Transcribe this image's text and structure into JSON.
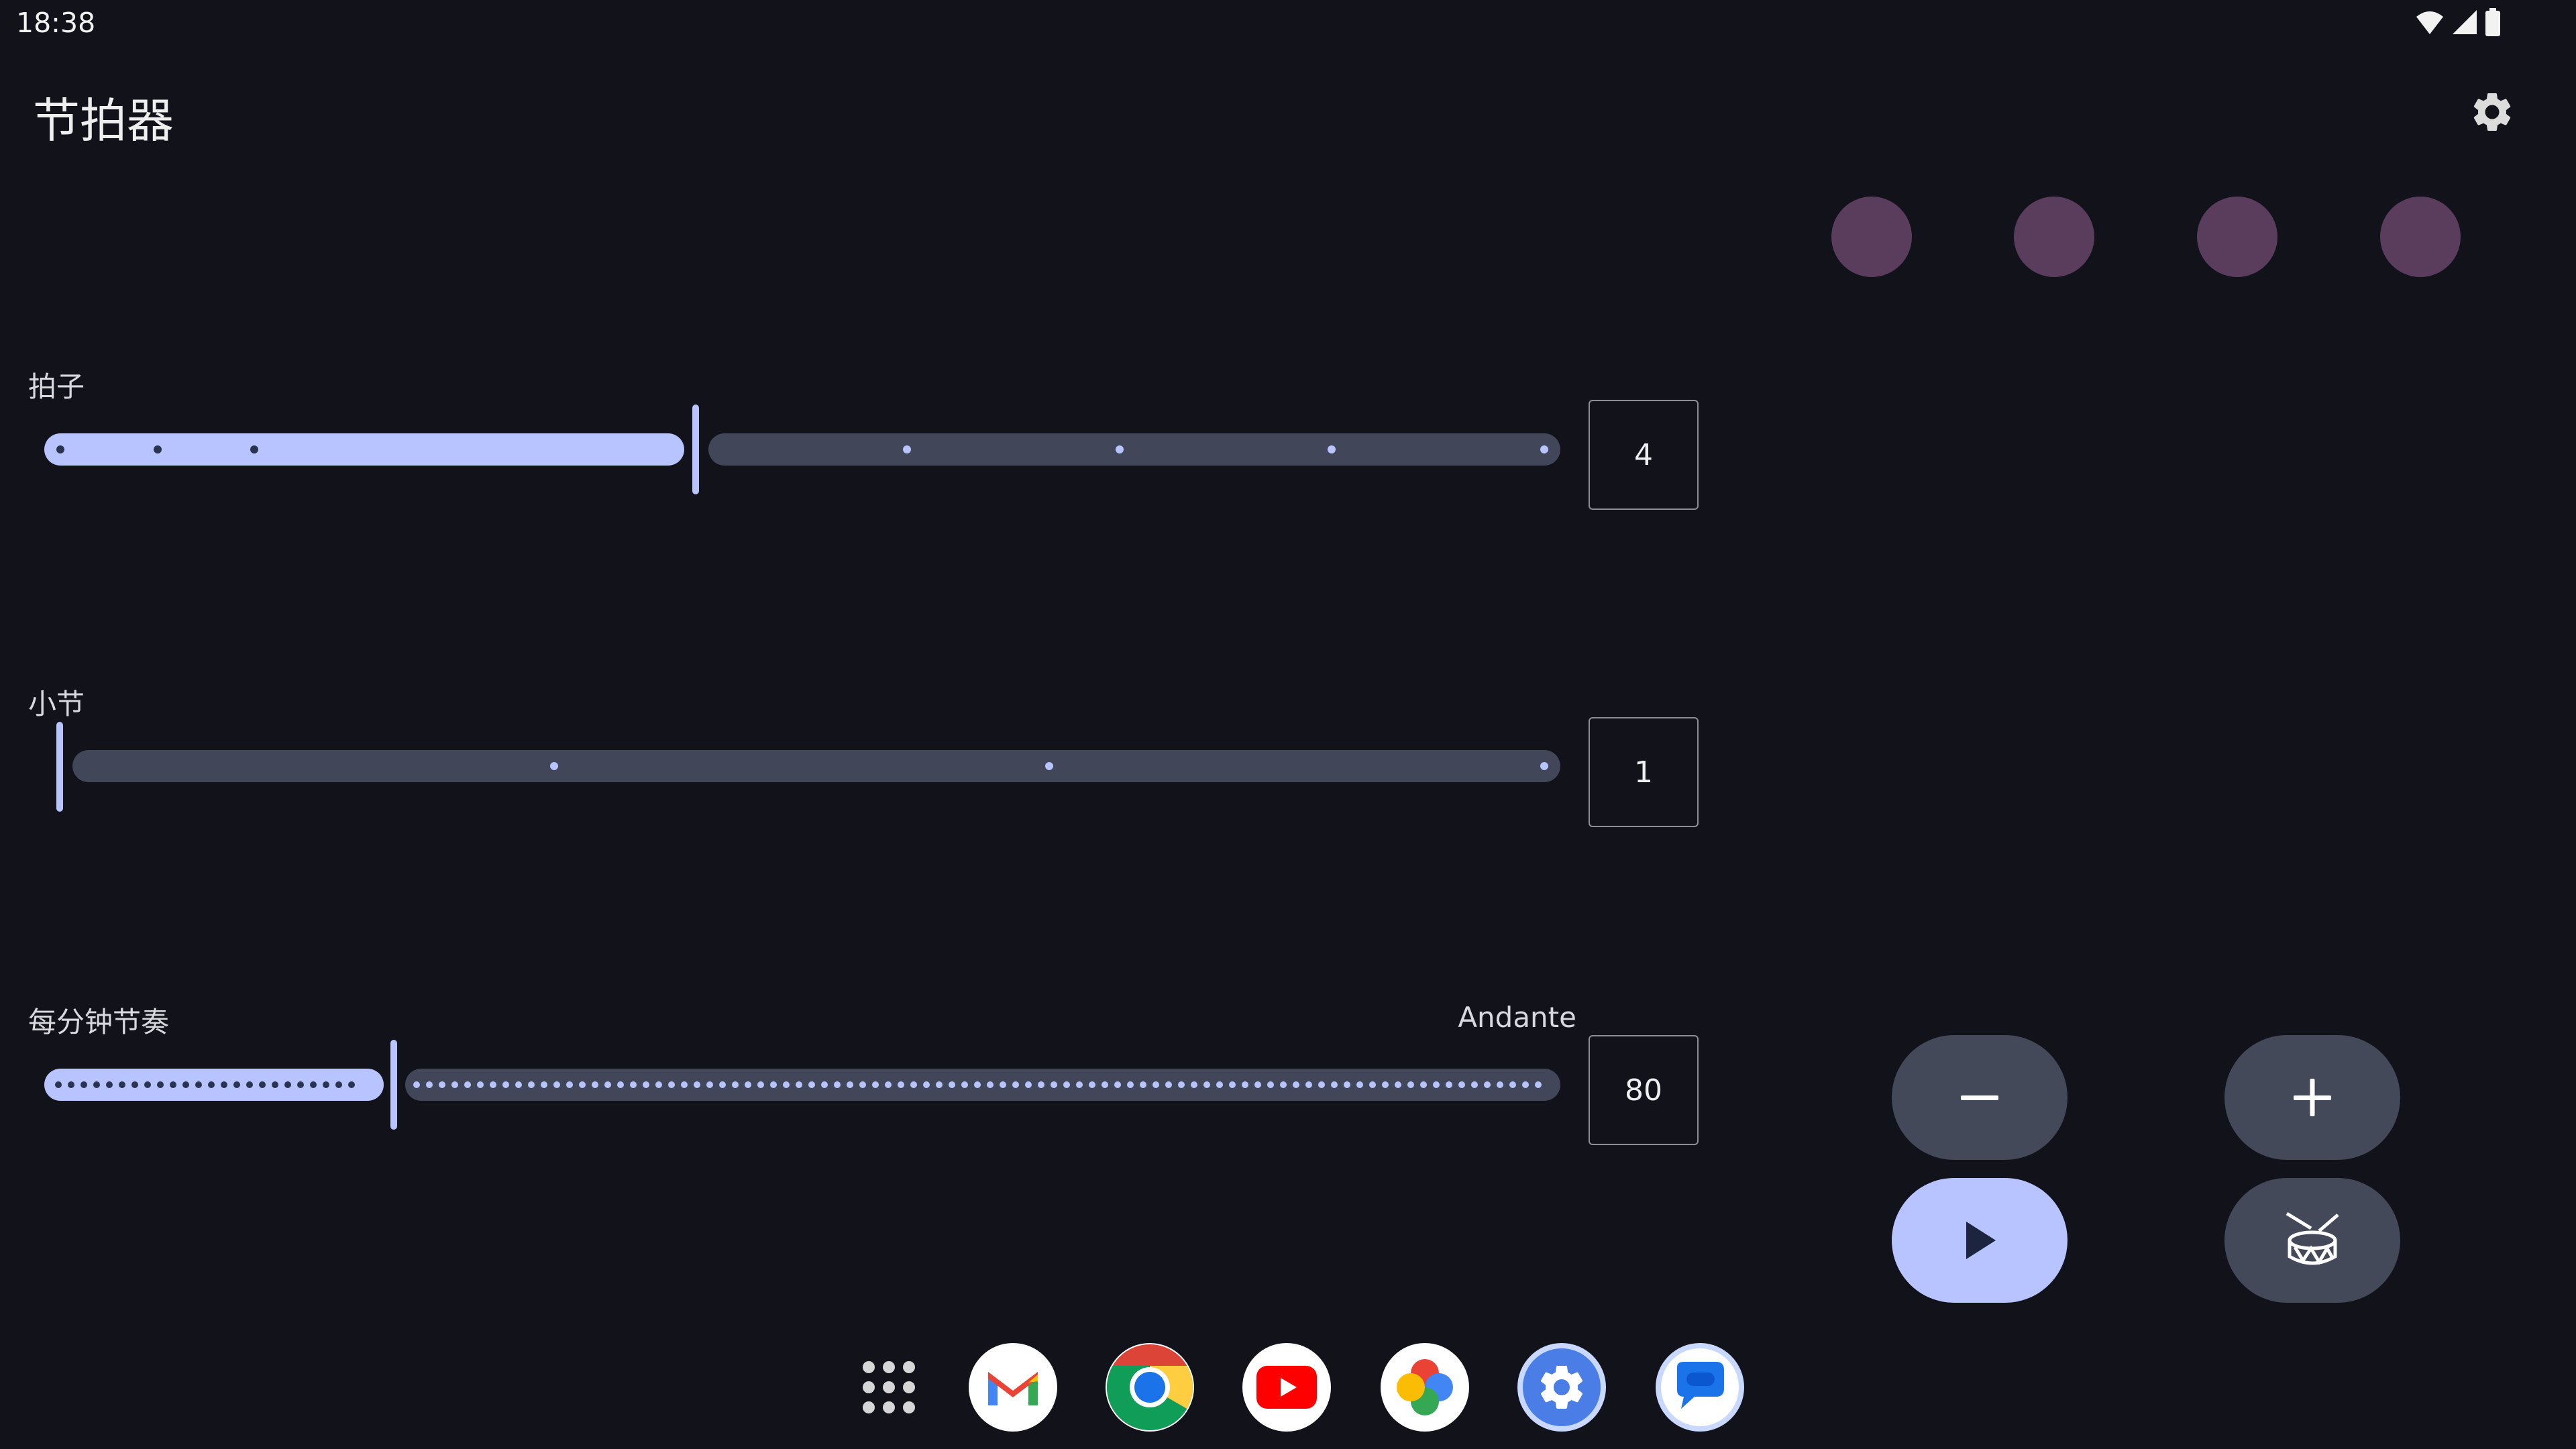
{
  "status_bar": {
    "time": "18:38"
  },
  "app": {
    "title": "节拍器"
  },
  "beat_indicators": {
    "count": 4,
    "color": "#5a3d5c"
  },
  "sliders": [
    {
      "label": "拍子",
      "value": "4",
      "fraction": 0.43
    },
    {
      "label": "小节",
      "value": "1",
      "fraction": 0.0
    },
    {
      "label": "每分钟节奏",
      "tempo_name": "Andante",
      "value": "80",
      "fraction": 0.23
    }
  ],
  "controls": {
    "minus_symbol": "–",
    "plus_symbol": "+"
  },
  "dock": {
    "apps": [
      "app-drawer-icon",
      "gmail-icon",
      "chrome-icon",
      "youtube-icon",
      "photos-icon",
      "settings-app-icon",
      "messages-icon"
    ]
  },
  "colors": {
    "accent": "#b7c4ff",
    "track_inactive": "#414759",
    "background": "#12131a"
  }
}
